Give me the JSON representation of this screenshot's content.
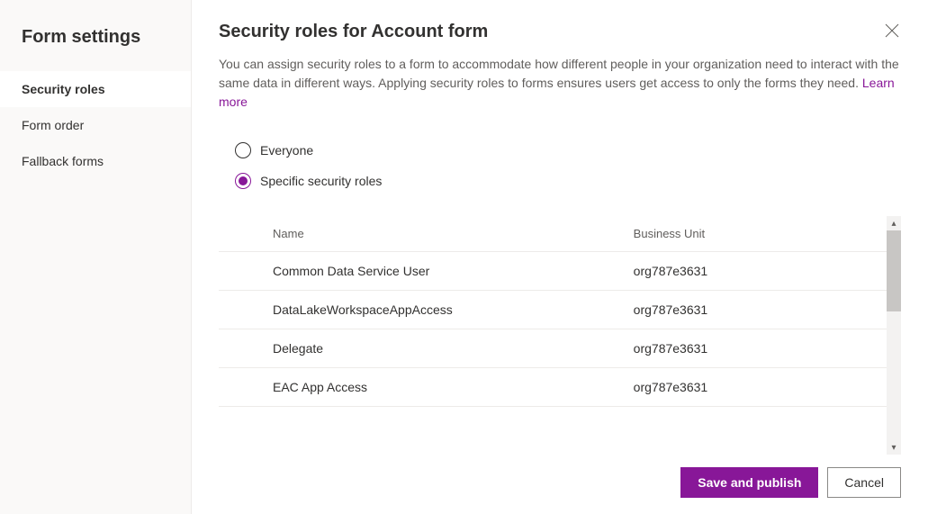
{
  "sidebar": {
    "title": "Form settings",
    "items": [
      {
        "label": "Security roles",
        "selected": true
      },
      {
        "label": "Form order",
        "selected": false
      },
      {
        "label": "Fallback forms",
        "selected": false
      }
    ]
  },
  "header": {
    "title": "Security roles for Account form"
  },
  "description": {
    "text": "You can assign security roles to a form to accommodate how different people in your organization need to interact with the same data in different ways. Applying security roles to forms ensures users get access to only the forms they need. ",
    "learnMore": "Learn more"
  },
  "radio": {
    "options": [
      {
        "label": "Everyone",
        "selected": false
      },
      {
        "label": "Specific security roles",
        "selected": true
      }
    ]
  },
  "table": {
    "headers": {
      "name": "Name",
      "businessUnit": "Business Unit"
    },
    "rows": [
      {
        "name": "Common Data Service User",
        "businessUnit": "org787e3631"
      },
      {
        "name": "DataLakeWorkspaceAppAccess",
        "businessUnit": "org787e3631"
      },
      {
        "name": "Delegate",
        "businessUnit": "org787e3631"
      },
      {
        "name": "EAC App Access",
        "businessUnit": "org787e3631"
      }
    ]
  },
  "footer": {
    "save": "Save and publish",
    "cancel": "Cancel"
  }
}
